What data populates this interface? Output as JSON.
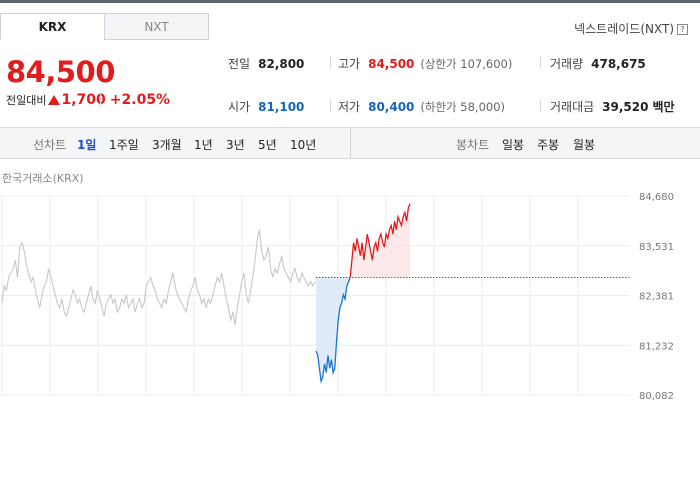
{
  "tabs": {
    "krx": "KRX",
    "nxt": "NXT"
  },
  "nextrade": {
    "label": "넥스트레이드(NXT)",
    "help": "?"
  },
  "quote": {
    "price": "84,500",
    "change_label": "전일대비",
    "change_amount": "1,700",
    "change_pct": "+2.05%"
  },
  "stats": {
    "prev_close": {
      "label": "전일",
      "value": "82,800"
    },
    "high": {
      "label": "고가",
      "value": "84,500",
      "limit": "(상한가 107,600)"
    },
    "volume": {
      "label": "거래량",
      "value": "478,675"
    },
    "open": {
      "label": "시가",
      "value": "81,100"
    },
    "low": {
      "label": "저가",
      "value": "80,400",
      "limit": "(하한가 58,000)"
    },
    "amount": {
      "label": "거래대금",
      "value": "39,520",
      "unit": "백만"
    }
  },
  "toolbar": {
    "line_chart": "선차트",
    "periods": [
      "1일",
      "1주일",
      "3개월",
      "1년",
      "3년",
      "5년",
      "10년"
    ],
    "active_period": "1일",
    "candle_chart": "봉차트",
    "candles": [
      "일봉",
      "주봉",
      "월봉"
    ]
  },
  "colors": {
    "up": "#e21c1c",
    "down": "#1565c0",
    "accent": "#1f4fbf"
  },
  "chart_data": {
    "type": "line",
    "title": "한국거래소(KRX)",
    "ylim": [
      80082,
      84680
    ],
    "y_ticks": [
      "84,680",
      "83,531",
      "82,381",
      "81,232",
      "80,082"
    ],
    "reference_line": 82800,
    "grid": true,
    "series": [
      {
        "values": [
          82200,
          82600,
          82500,
          82800,
          82900,
          83000,
          83200,
          82800,
          83500,
          83600,
          83400,
          83100,
          82900,
          82700,
          82800,
          82500,
          82300,
          82100,
          82400,
          82600,
          82700,
          83000,
          82800,
          82600,
          82400,
          82200,
          82100,
          82300,
          82000,
          81900,
          82100,
          82300,
          82500,
          82400,
          82200,
          82300,
          82100,
          82000,
          82200,
          82400,
          82600,
          82300,
          82200,
          82500,
          82300,
          82100,
          81900,
          82200,
          82300,
          82400,
          82200,
          82300,
          82000,
          82100,
          82300,
          82200,
          82400,
          82100,
          82200,
          82300,
          82000,
          82200,
          82300,
          82100,
          82200,
          82600,
          82700,
          82800,
          82600,
          82500,
          82300,
          82200,
          82100,
          82300,
          82200,
          82500,
          82700,
          82900,
          82600,
          82400,
          82300,
          82200,
          82100,
          82000,
          82300,
          82500,
          82600,
          82800,
          82500,
          82400,
          82200,
          82300,
          82100,
          82300,
          82200,
          82400,
          82600,
          82800,
          82700,
          82900,
          82600,
          82300,
          82100,
          81800,
          82000,
          81700,
          82100,
          82400,
          82700,
          82900,
          82400,
          82200,
          82500,
          82800,
          83200,
          83700,
          83900,
          83400,
          83200,
          83300,
          83500,
          83000,
          82800,
          83000,
          82900,
          83100,
          83300,
          83000,
          82900,
          82800,
          82700,
          82900,
          83000,
          82800,
          82700,
          82900,
          82800,
          82700,
          82600,
          82700,
          82600,
          82700
        ]
      },
      {
        "values": [
          81100,
          81000,
          80700,
          80400,
          80500,
          80800,
          80600,
          81000,
          80700,
          80900,
          80600,
          80700,
          81300,
          81800,
          82100,
          82200,
          82400,
          82300,
          82600,
          82700,
          82800,
          83200,
          83600,
          83400,
          83700,
          83500,
          83300,
          83600,
          83200,
          83500,
          83800,
          83600,
          83400,
          83200,
          83500,
          83600,
          83400,
          83700,
          83800,
          83600,
          83500,
          83800,
          83700,
          83900,
          84000,
          83800,
          84100,
          83900,
          84200,
          84100,
          84000,
          84200,
          84300,
          84100,
          84400,
          84500
        ]
      }
    ]
  }
}
